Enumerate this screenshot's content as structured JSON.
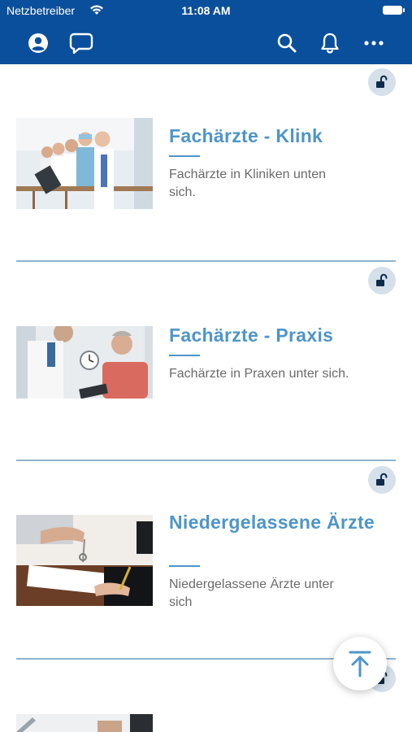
{
  "status_bar": {
    "carrier": "Netzbetreiber",
    "time": "11:08 AM"
  },
  "nav": {
    "icons": [
      "profile-icon",
      "chat-icon",
      "search-icon",
      "bell-icon",
      "more-icon"
    ]
  },
  "cards": [
    {
      "title": "Fachärzte - Klink",
      "description": "Fachärzte in Kliniken unten sich.",
      "image": "doctors-team-photo",
      "lock": "unlocked"
    },
    {
      "title": "Fachärzte - Praxis",
      "description": "Fachärzte in Praxen unter sich.",
      "image": "doctor-patient-photo",
      "lock": "unlocked"
    },
    {
      "title": "Niedergelassene Ärzte",
      "description": "Niedergelassene Ärzte unter sich",
      "image": "contract-keys-photo",
      "lock": "unlocked"
    }
  ],
  "colors": {
    "header": "#0a4f9c",
    "accent": "#4f95c8",
    "divider": "#8fb3cf",
    "lock_bg": "#d5e0ea",
    "lock_icon": "#0f2b4c"
  },
  "fab_icon": "scroll-to-top-icon"
}
